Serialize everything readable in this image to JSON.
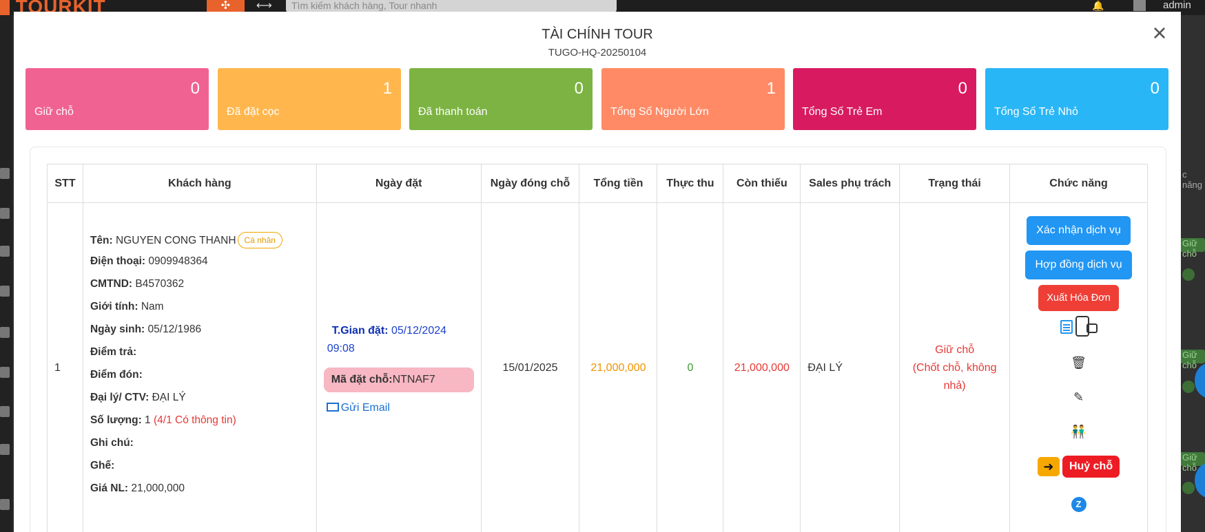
{
  "background": {
    "logo": "TOURKIT",
    "search_placeholder": "Tìm kiếm khách hàng, Tour nhanh",
    "user": "admin",
    "right_edge_label": "c năng",
    "right_chips": [
      "Giữ chỗ",
      "Giữ chỗ",
      "Giữ chỗ"
    ]
  },
  "modal": {
    "title": "TÀI CHÍNH TOUR",
    "subtitle": "TUGO-HQ-20250104",
    "close_glyph": "×"
  },
  "stats": [
    {
      "label": "Giữ chỗ",
      "value": "0",
      "color": "#f06292"
    },
    {
      "label": "Đã đặt cọc",
      "value": "1",
      "color": "#ffb74d"
    },
    {
      "label": "Đã thanh toán",
      "value": "0",
      "color": "#7cb342"
    },
    {
      "label": "Tổng Số Người Lớn",
      "value": "1",
      "color": "#ff8a65"
    },
    {
      "label": "Tổng Số Trẻ Em",
      "value": "0",
      "color": "#d81b60"
    },
    {
      "label": "Tổng Số Trẻ Nhỏ",
      "value": "0",
      "color": "#29b6f6"
    }
  ],
  "table": {
    "headers": [
      "STT",
      "Khách hàng",
      "Ngày đặt",
      "Ngày đóng chỗ",
      "Tổng tiền",
      "Thực thu",
      "Còn thiếu",
      "Sales phụ trách",
      "Trạng thái",
      "Chức năng"
    ],
    "row": {
      "stt": "1",
      "customer": {
        "name_label": "Tên:",
        "name": "NGUYEN CONG THANH",
        "type_badge": "Cá nhân",
        "phone_label": "Điện thoại:",
        "phone": "0909948364",
        "id_label": "CMTND:",
        "id": "B4570362",
        "gender_label": "Giới tính:",
        "gender": "Nam",
        "dob_label": "Ngày sinh:",
        "dob": "05/12/1986",
        "dropoff_label": "Điểm trả:",
        "pickup_label": "Điểm đón:",
        "agent_label": "Đại lý/ CTV:",
        "agent": "ĐẠI LÝ",
        "qty_label": "Số lượng:",
        "qty": "1",
        "qty_note": "(4/1 Có thông tin)",
        "note_label": "Ghi chú:",
        "seat_label": "Ghế:",
        "price_label": "Giá NL:",
        "price": "21,000,000"
      },
      "booked": {
        "time_label": "T.Gian đặt:",
        "date": "05/12/2024",
        "time": "09:08",
        "code_label": "Mã đặt chỗ:",
        "code": "NTNAF7",
        "email_label": "Gửi Email"
      },
      "close_date": "15/01/2025",
      "total": "21,000,000",
      "paid": "0",
      "remaining": "21,000,000",
      "sales": "ĐẠI LÝ",
      "status_line1": "Giữ chỗ",
      "status_line2": "(Chốt chỗ, không nhả)",
      "actions": {
        "confirm": "Xác nhận dịch vụ",
        "contract": "Hợp đồng dịch vụ",
        "invoice": "Xuất Hóa Đơn",
        "cancel": "Huỷ chỗ"
      }
    }
  }
}
